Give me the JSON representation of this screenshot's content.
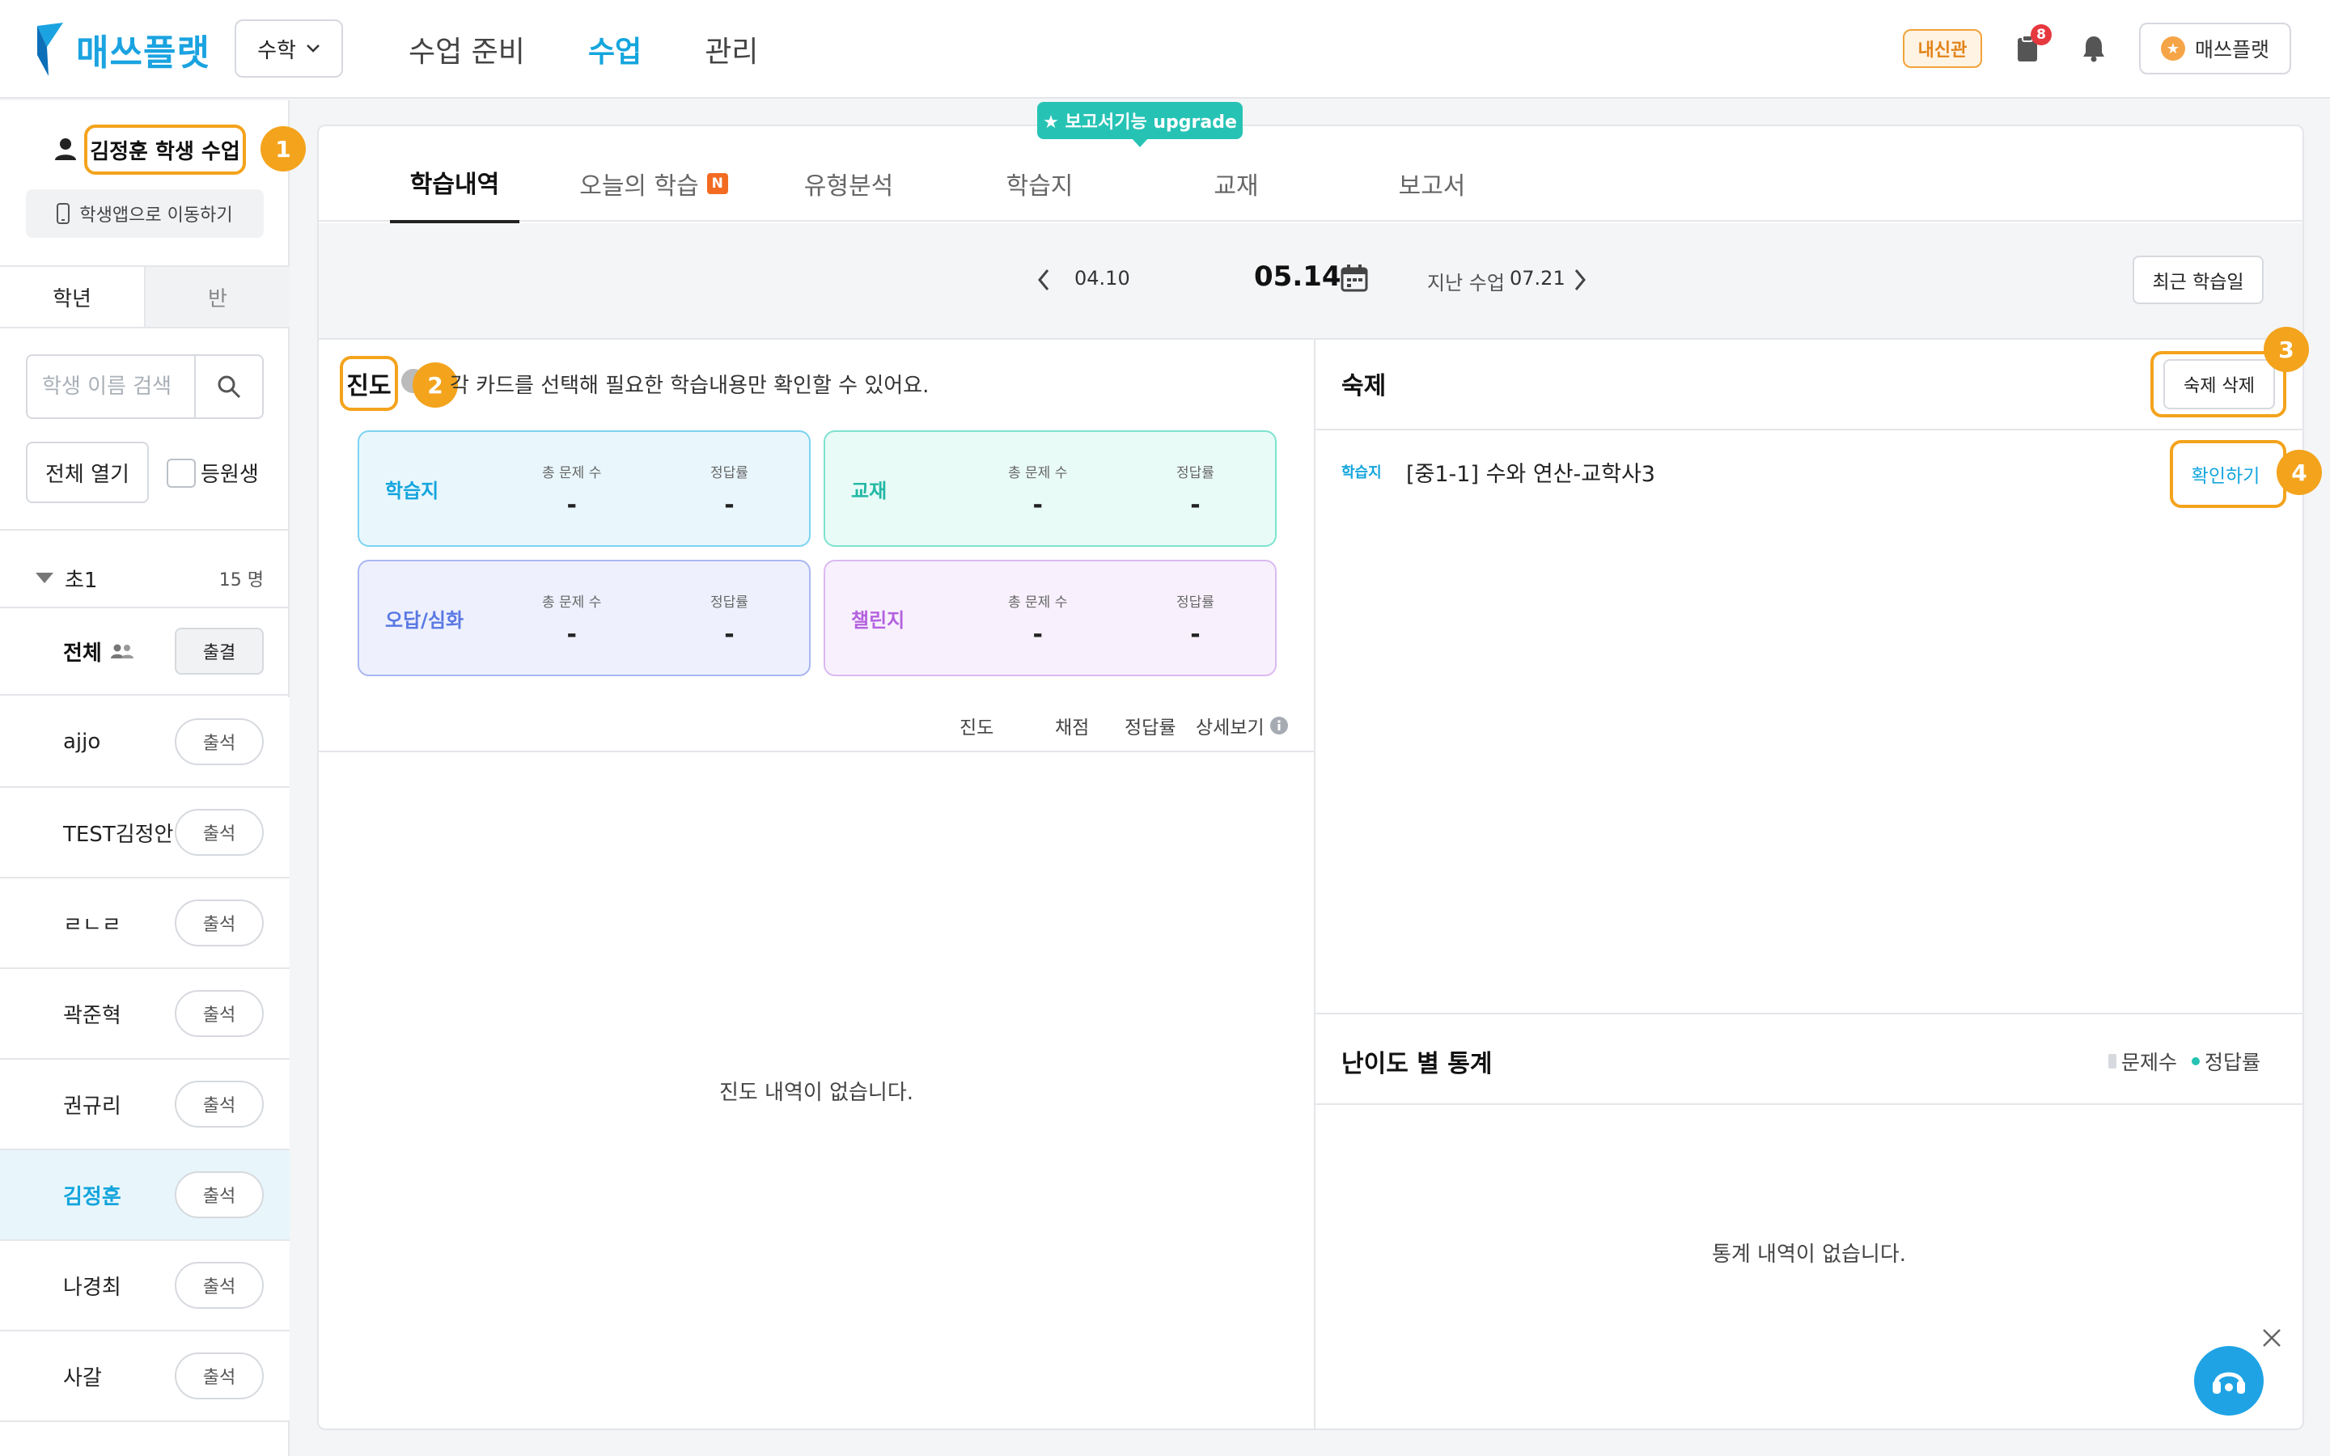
{
  "header": {
    "brand": "매쓰플랫",
    "subject_select": "수학",
    "nav": [
      "수업 준비",
      "수업",
      "관리"
    ],
    "nav_active": "수업",
    "naesin_badge": "내신관",
    "notification_count": "8",
    "user_label": "매쓰플랫",
    "colors": {
      "brand": "#1aa3e0",
      "accent": "#14a5dd",
      "badge": "#e2831a",
      "callout": "#f3a31c"
    }
  },
  "sidebar": {
    "student_title": "김정훈 학생 수업",
    "app_button": "학생앱으로 이동하기",
    "tabs": [
      "학년",
      "반"
    ],
    "search_placeholder": "학생 이름 검색",
    "open_all": "전체 열기",
    "enrolled_checkbox": "등원생",
    "group": {
      "name": "초1",
      "count": "15 명"
    },
    "all_label": "전체",
    "all_attend_btn": "출결",
    "students": [
      {
        "name": "ajjo",
        "btn": "출석"
      },
      {
        "name": "TEST김정안",
        "btn": "출석"
      },
      {
        "name": "ㄹㄴㄹ",
        "btn": "출석"
      },
      {
        "name": "곽준혁",
        "btn": "출석"
      },
      {
        "name": "권규리",
        "btn": "출석"
      },
      {
        "name": "김정훈",
        "btn": "출석"
      },
      {
        "name": "나경최",
        "btn": "출석"
      },
      {
        "name": "사갈",
        "btn": "출석"
      }
    ]
  },
  "callouts": [
    "1",
    "2",
    "3",
    "4"
  ],
  "main": {
    "upgrade_badge": "★ 보고서기능 upgrade",
    "tabs": [
      "학습내역",
      "오늘의 학습",
      "유형분석",
      "학습지",
      "교재",
      "보고서"
    ],
    "new_badge": "N",
    "date": {
      "prev": "04.10",
      "current": "05.14",
      "last_label": "지난 수업",
      "last_value": "07.21"
    },
    "recent_button": "최근 학습일",
    "progress": {
      "title": "진도",
      "description": "각 카드를 선택해 필요한 학습내용만 확인할 수 있어요.",
      "cards": [
        {
          "label": "학습지",
          "total_label": "총 문제 수",
          "total": "-",
          "rate_label": "정답률",
          "rate": "-"
        },
        {
          "label": "교재",
          "total_label": "총 문제 수",
          "total": "-",
          "rate_label": "정답률",
          "rate": "-"
        },
        {
          "label": "오답/심화",
          "total_label": "총 문제 수",
          "total": "-",
          "rate_label": "정답률",
          "rate": "-"
        },
        {
          "label": "챌린지",
          "total_label": "총 문제 수",
          "total": "-",
          "rate_label": "정답률",
          "rate": "-"
        }
      ],
      "columns": [
        "진도",
        "채점",
        "정답률",
        "상세보기"
      ],
      "empty": "진도 내역이 없습니다."
    },
    "homework": {
      "title": "숙제",
      "delete_button": "숙제 삭제",
      "items": [
        {
          "tag": "학습지",
          "title": "[중1-1] 수와 연산-교학사3",
          "action": "확인하기"
        }
      ]
    },
    "difficulty": {
      "title": "난이도 별 통계",
      "legend": [
        "문제수",
        "정답률"
      ],
      "empty": "통계 내역이 없습니다."
    }
  }
}
